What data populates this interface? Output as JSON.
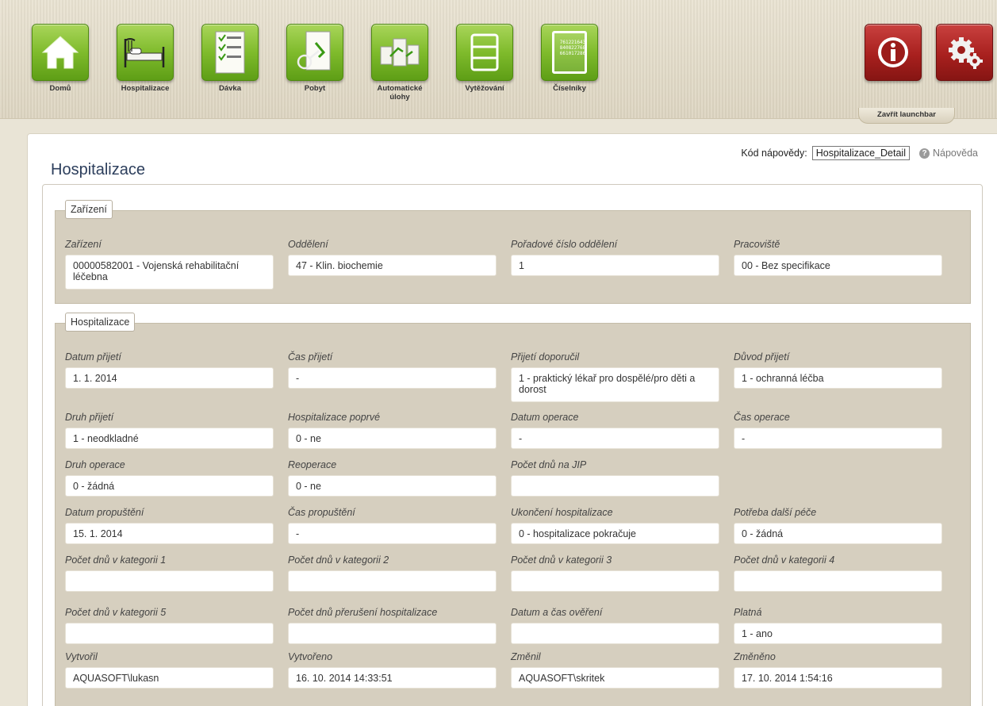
{
  "launchbar": {
    "items": [
      {
        "label": "Domů",
        "icon": "home-icon"
      },
      {
        "label": "Hospitalizace",
        "icon": "hospital-bed-icon"
      },
      {
        "label": "Dávka",
        "icon": "checklist-icon"
      },
      {
        "label": "Pobyt",
        "icon": "document-key-icon"
      },
      {
        "label": "Automatické úlohy",
        "icon": "automation-documents-icon"
      },
      {
        "label": "Vytěžování",
        "icon": "form-grid-icon"
      },
      {
        "label": "Číselníky",
        "icon": "codebook-icon"
      }
    ],
    "codebook_digits": "761221643\n840822768\n661017286",
    "close_label": "Zavřít launchbar",
    "colors": {
      "green": "#7fbb2c",
      "red": "#a8201e"
    }
  },
  "page": {
    "title": "Hospitalizace",
    "help_code_label": "Kód nápovědy:",
    "help_code_value": "Hospitalizace_Detail",
    "help_link": "Nápověda"
  },
  "sections": {
    "zarizeni": {
      "legend": "Zařízení",
      "fields": [
        {
          "label": "Zařízení",
          "value": "00000582001 - Vojenská rehabilitační léčebna"
        },
        {
          "label": "Oddělení",
          "value": "47 - Klin. biochemie"
        },
        {
          "label": "Pořadové číslo oddělení",
          "value": "1"
        },
        {
          "label": "Pracoviště",
          "value": "00 - Bez specifikace"
        }
      ]
    },
    "hospitalizace": {
      "legend": "Hospitalizace",
      "fields": [
        {
          "label": "Datum přijetí",
          "value": "1. 1. 2014"
        },
        {
          "label": "Čas přijetí",
          "value": "-"
        },
        {
          "label": "Přijetí doporučil",
          "value": "1 - praktický lékař pro dospělé/pro děti a dorost"
        },
        {
          "label": "Důvod přijetí",
          "value": "1 - ochranná léčba"
        },
        {
          "label": "Druh přijetí",
          "value": "1 - neodkladné"
        },
        {
          "label": "Hospitalizace poprvé",
          "value": "0 - ne"
        },
        {
          "label": "Datum operace",
          "value": "-"
        },
        {
          "label": "Čas operace",
          "value": "-"
        },
        {
          "label": "Druh operace",
          "value": "0 - žádná"
        },
        {
          "label": "Reoperace",
          "value": "0 - ne"
        },
        {
          "label": "Počet dnů na JIP",
          "value": ""
        },
        {
          "label": "Datum propuštění",
          "value": "15. 1. 2014"
        },
        {
          "label": "Čas propuštění",
          "value": "-"
        },
        {
          "label": "Ukončení hospitalizace",
          "value": "0 - hospitalizace pokračuje"
        },
        {
          "label": "Potřeba další péče",
          "value": "0 - žádná"
        },
        {
          "label": "Počet dnů v kategorii 1",
          "value": ""
        },
        {
          "label": "Počet dnů v kategorii 2",
          "value": ""
        },
        {
          "label": "Počet dnů v kategorii 3",
          "value": ""
        },
        {
          "label": "Počet dnů v kategorii 4",
          "value": ""
        },
        {
          "label": "Počet dnů v kategorii 5",
          "value": ""
        },
        {
          "label": "Počet dnů přerušení hospitalizace",
          "value": ""
        },
        {
          "label": "Datum a čas ověření",
          "value": ""
        },
        {
          "label": "Platná",
          "value": "1 - ano"
        },
        {
          "label": "Vytvořil",
          "value": "AQUASOFT\\lukasn"
        },
        {
          "label": "Vytvořeno",
          "value": "16. 10. 2014 14:33:51"
        },
        {
          "label": "Změnil",
          "value": "AQUASOFT\\skritek"
        },
        {
          "label": "Změněno",
          "value": "17. 10. 2014 1:54:16"
        }
      ]
    }
  }
}
